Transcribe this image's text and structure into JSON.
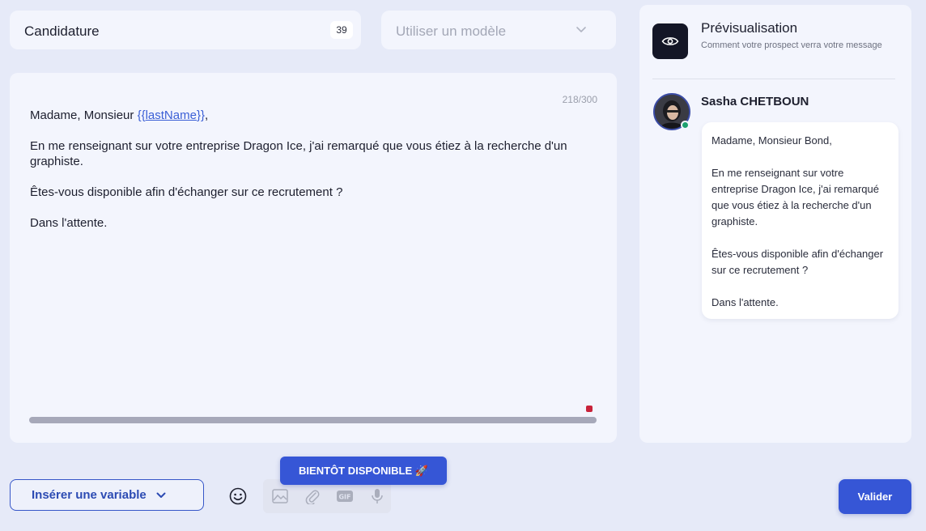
{
  "header": {
    "title_value": "Candidature",
    "title_count": "39",
    "template_placeholder": "Utiliser un modèle"
  },
  "editor": {
    "char_counter": "218/300",
    "line1_prefix": "Madame, Monsieur ",
    "variable_open": "{{",
    "variable_name": "lastName",
    "variable_close": "}}",
    "line1_suffix": ",",
    "paragraph2": "En me renseignant sur votre entreprise Dragon Ice, j'ai remarqué que vous étiez à la recherche d'un graphiste.",
    "paragraph3": "Êtes-vous disponible afin d'échanger sur ce recrutement ?",
    "paragraph4": "Dans l'attente."
  },
  "preview": {
    "title": "Prévisualisation",
    "subtitle": "Comment votre prospect verra votre message",
    "sender_name": "Sasha CHETBOUN",
    "message": {
      "p1": "Madame, Monsieur Bond,",
      "p2": "En me renseignant sur votre entreprise Dragon Ice, j'ai remarqué que vous étiez à la recherche d'un graphiste.",
      "p3": "Êtes-vous disponible afin d'échanger sur ce recrutement ?",
      "p4": "Dans l'attente."
    }
  },
  "footer": {
    "insert_variable_label": "Insérer une variable",
    "coming_soon_label": "BIENTÔT DISPONIBLE 🚀",
    "validate_label": "Valider"
  },
  "colors": {
    "accent": "#3656d6",
    "background": "#e6eaf8",
    "card": "#f3f5fd",
    "online": "#1ca06e",
    "recording": "#c8223a"
  },
  "icons": {
    "template_dropdown": "chevron-down-icon",
    "preview": "eye-icon",
    "insert_variable": "chevron-down-icon",
    "emoji": "smiley-icon",
    "image": "image-icon",
    "attachment": "paperclip-icon",
    "gif": "gif-icon",
    "microphone": "microphone-icon"
  }
}
